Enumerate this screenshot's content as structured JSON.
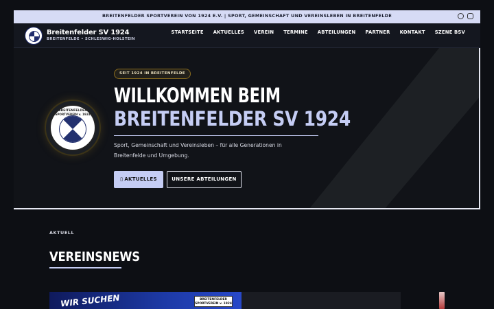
{
  "topbar": {
    "text": "BREITENFELDER SPORTVEREIN VON 1924 E.V.  |  SPORT, GEMEINSCHAFT UND VEREINSLEBEN IN BREITENFELDE",
    "icons": [
      "facebook-icon",
      "instagram-icon"
    ]
  },
  "header": {
    "brand_name": "Breitenfelder SV 1924",
    "brand_sub": "BREITENFELDE • SCHLESWIG-HOLSTEIN",
    "nav": [
      "STARTSEITE",
      "AKTUELLES",
      "VEREIN",
      "TERMINE",
      "ABTEILUNGEN",
      "PARTNER",
      "KONTAKT",
      "SZENE BSV"
    ]
  },
  "hero": {
    "badge": "SEIT 1924 IN BREITENFELDE",
    "title_line1": "WILLKOMMEN BEIM",
    "title_line2": "BREITENFELDER SV 1924",
    "description": "Sport, Gemeinschaft und Vereinsleben – für alle Generationen in Breitenfelde und Umgebung.",
    "crest_text1": "BREITENFELDER",
    "crest_text2": "SPORTVEREIN v. 1924",
    "primary_button": "AKTUELLES",
    "primary_button_icon": "newspaper-icon",
    "secondary_button": "UNSERE ABTEILUNGEN"
  },
  "news": {
    "label": "AKTUELL",
    "title": "VEREINSNEWS",
    "card1_text": "WIR SUCHEN",
    "card1_badge_line1": "BREITENFELDER",
    "card1_badge_line2": "SPORTVEREIN v. 1924"
  },
  "colors": {
    "topbar": "#d6dbf5",
    "navbar": "#14171f",
    "accent": "#c5cdf4",
    "badge_border": "#8a6c1e"
  }
}
